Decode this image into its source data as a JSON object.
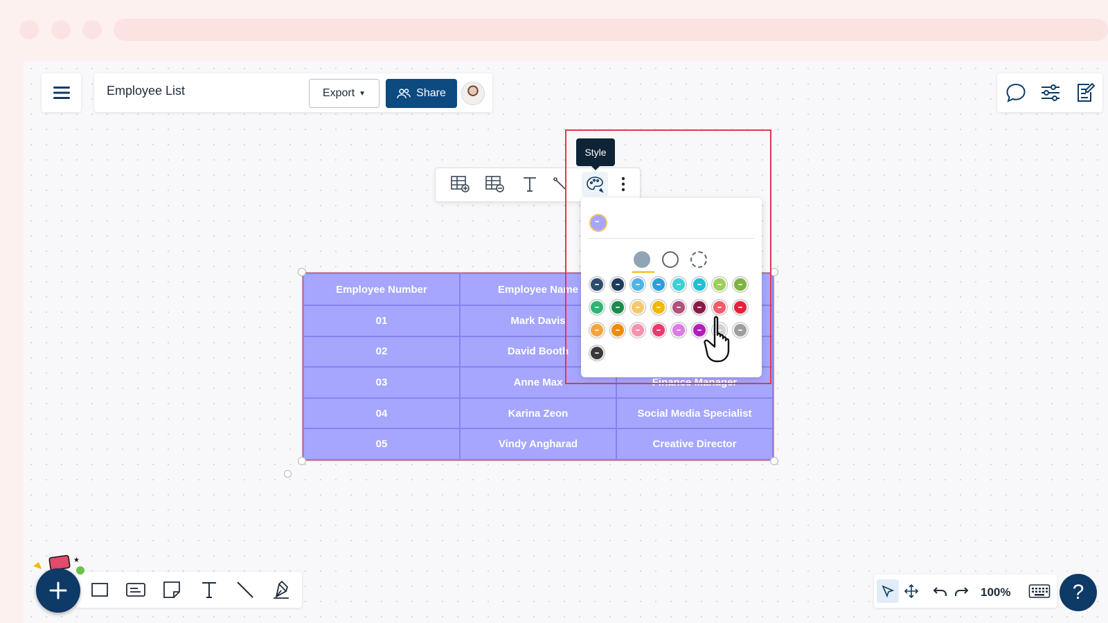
{
  "document": {
    "title": "Employee List"
  },
  "header": {
    "export_label": "Export",
    "share_label": "Share"
  },
  "tooltip": {
    "style_label": "Style"
  },
  "table": {
    "columns": [
      "Employee Number",
      "Employee Name",
      ""
    ],
    "rows": [
      [
        "01",
        "Mark Davis",
        ""
      ],
      [
        "02",
        "David Booth",
        ""
      ],
      [
        "03",
        "Anne Max",
        "Finance Manager"
      ],
      [
        "04",
        "Karina Zeon",
        "Social Media Specialist"
      ],
      [
        "05",
        "Vindy Angharad",
        "Creative Director"
      ]
    ]
  },
  "style_panel": {
    "current_color": "#a6a6ff",
    "fill_modes": [
      "solid",
      "outline",
      "dashed"
    ],
    "palette": [
      [
        "#2f4b6e",
        "#1f3b5a",
        "#4fb3e8",
        "#2aa0dc",
        "#3fcfd6",
        "#1ec0d6",
        "#9ccf5a",
        "#7cb342"
      ],
      [
        "#2bb673",
        "#1e8b4e",
        "#f5c96b",
        "#f2b705",
        "#b0517e",
        "#8b1a48",
        "#f25c6a",
        "#e0243c"
      ],
      [
        "#f7a440",
        "#f28a10",
        "#f592ae",
        "#ea3a6e",
        "#dc7ae6",
        "#b21fb8",
        "#d3d3d3",
        "#9e9e9e"
      ],
      [
        "#3a3a3a"
      ]
    ]
  },
  "status": {
    "zoom": "100%",
    "help": "?"
  },
  "colors": {
    "accent": "#0d4a80",
    "table_fill": "#a6a6ff",
    "highlight": "#e0384d"
  }
}
